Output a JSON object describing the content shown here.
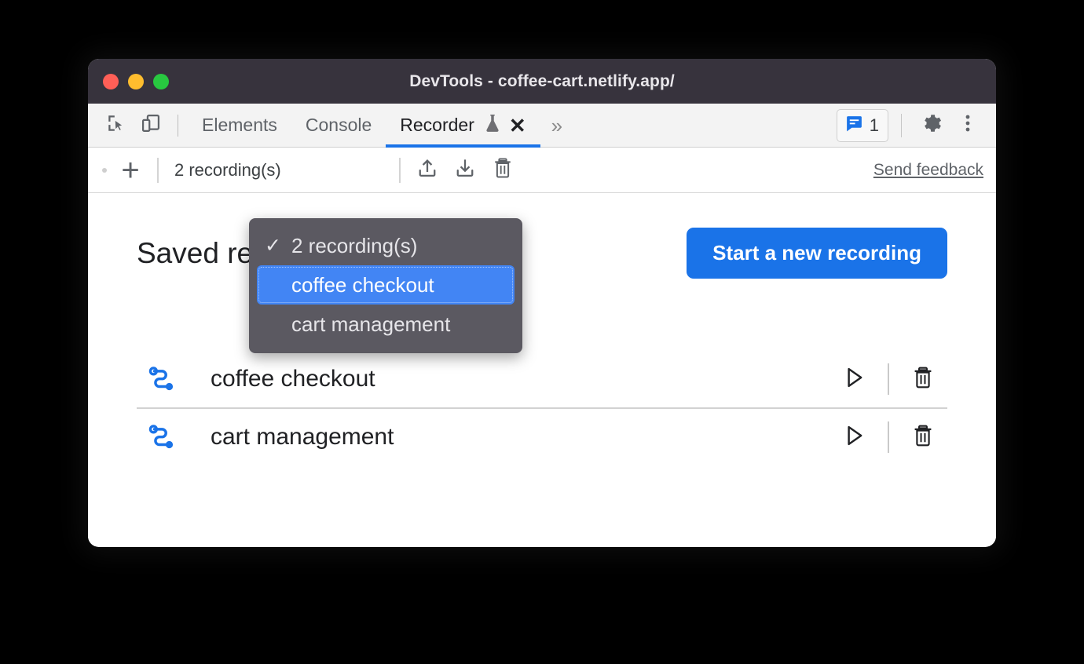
{
  "window": {
    "title": "DevTools - coffee-cart.netlify.app/",
    "traffic_lights": [
      {
        "name": "close",
        "color": "#ff5f57"
      },
      {
        "name": "minimize",
        "color": "#ffbd2e"
      },
      {
        "name": "maximize",
        "color": "#28c840"
      }
    ]
  },
  "tabbar": {
    "left_icons": [
      {
        "name": "inspect-element-icon"
      },
      {
        "name": "device-toolbar-icon"
      }
    ],
    "tabs": [
      {
        "label": "Elements",
        "active": false
      },
      {
        "label": "Console",
        "active": false
      },
      {
        "label": "Recorder",
        "active": true,
        "experimental": true,
        "closable": true
      }
    ],
    "more_tabs_glyph": "»",
    "close_glyph": "✕",
    "issues": {
      "count": "1",
      "icon": "issues-message-icon"
    },
    "settings_icon": "gear-icon",
    "more_options_icon": "three-dot-menu-icon"
  },
  "recorder_toolbar": {
    "add_label": "+",
    "select_value": "2 recording(s)",
    "actions": [
      {
        "name": "export-icon",
        "label": "Export"
      },
      {
        "name": "import-icon",
        "label": "Import"
      },
      {
        "name": "delete-icon",
        "label": "Delete"
      }
    ],
    "feedback_label": "Send feedback"
  },
  "dropdown": {
    "visible": true,
    "items": [
      {
        "label": "2 recording(s)",
        "checked": true,
        "selected": false
      },
      {
        "label": "coffee checkout",
        "checked": false,
        "selected": true
      },
      {
        "label": "cart management",
        "checked": false,
        "selected": false
      }
    ],
    "check_glyph": "✓"
  },
  "main": {
    "title": "Saved recordings",
    "start_button_label": "Start a new recording",
    "recordings": [
      {
        "name": "coffee checkout",
        "icon": "recording-flow-icon",
        "play": "play-icon",
        "delete": "trash-icon"
      },
      {
        "name": "cart management",
        "icon": "recording-flow-icon",
        "play": "play-icon",
        "delete": "trash-icon"
      }
    ]
  },
  "colors": {
    "accent": "#1a73e8",
    "dropdown_selected": "#4285f4",
    "titlebar": "#37333d",
    "dropdown_bg": "#5b5961",
    "recording_icon": "#1a73e8"
  }
}
